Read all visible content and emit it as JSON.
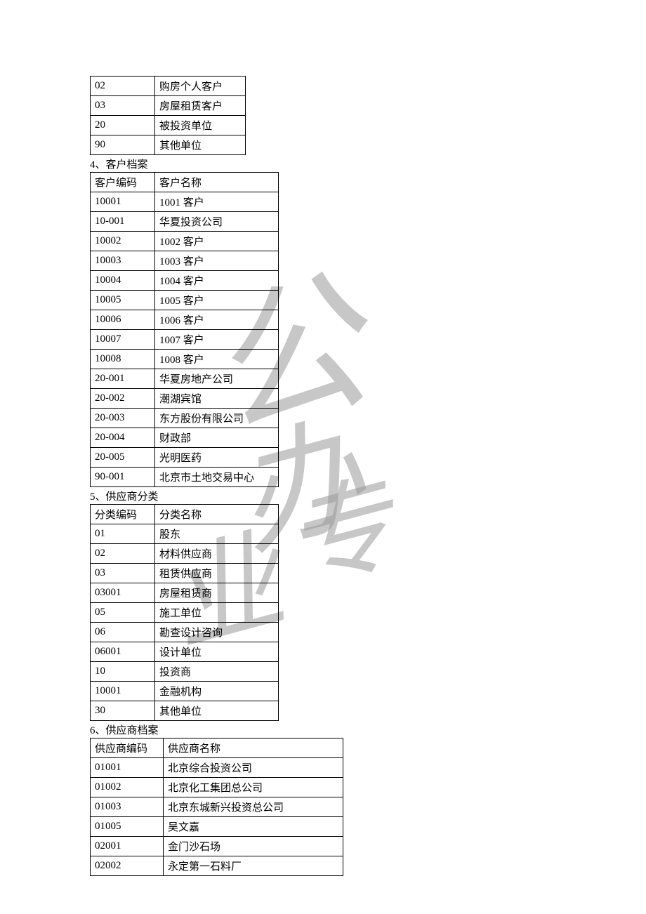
{
  "table0": {
    "rows": [
      {
        "c0": "02",
        "c1": "购房个人客户"
      },
      {
        "c0": "03",
        "c1": "房屋租赁客户"
      },
      {
        "c0": "20",
        "c1": "被投资单位"
      },
      {
        "c0": "90",
        "c1": "其他单位"
      }
    ]
  },
  "section1": {
    "title": "4、客户档案",
    "header": {
      "c0": "客户编码",
      "c1": "客户名称"
    },
    "rows": [
      {
        "c0": "10001",
        "c1": "1001 客户"
      },
      {
        "c0": "10-001",
        "c1": "华夏投资公司"
      },
      {
        "c0": "10002",
        "c1": "1002 客户"
      },
      {
        "c0": "10003",
        "c1": "1003 客户"
      },
      {
        "c0": "10004",
        "c1": "1004 客户"
      },
      {
        "c0": "10005",
        "c1": "1005 客户"
      },
      {
        "c0": "10006",
        "c1": "1006 客户"
      },
      {
        "c0": "10007",
        "c1": "1007 客户"
      },
      {
        "c0": "10008",
        "c1": "1008 客户"
      },
      {
        "c0": "20-001",
        "c1": "华夏房地产公司"
      },
      {
        "c0": "20-002",
        "c1": "潮湖宾馆"
      },
      {
        "c0": "20-003",
        "c1": "东方股份有限公司"
      },
      {
        "c0": "20-004",
        "c1": "财政部"
      },
      {
        "c0": "20-005",
        "c1": "光明医药"
      },
      {
        "c0": "90-001",
        "c1": "北京市土地交易中心"
      }
    ]
  },
  "section2": {
    "title": "5、供应商分类",
    "header": {
      "c0": "分类编码",
      "c1": "分类名称"
    },
    "rows": [
      {
        "c0": "01",
        "c1": "股东"
      },
      {
        "c0": "02",
        "c1": "材料供应商"
      },
      {
        "c0": "03",
        "c1": "租赁供应商"
      },
      {
        "c0": "03001",
        "c1": "房屋租赁商"
      },
      {
        "c0": "05",
        "c1": "施工单位"
      },
      {
        "c0": "06",
        "c1": "勘查设计咨询"
      },
      {
        "c0": "06001",
        "c1": "设计单位"
      },
      {
        "c0": "10",
        "c1": "投资商"
      },
      {
        "c0": "10001",
        "c1": "金融机构"
      },
      {
        "c0": "30",
        "c1": "其他单位"
      }
    ]
  },
  "section3": {
    "title": "6、供应商档案",
    "header": {
      "c0": "供应商编码",
      "c1": "供应商名称"
    },
    "rows": [
      {
        "c0": "01001",
        "c1": "北京综合投资公司"
      },
      {
        "c0": "01002",
        "c1": "北京化工集团总公司"
      },
      {
        "c0": "01003",
        "c1": "北京东城新兴投资总公司"
      },
      {
        "c0": "01005",
        "c1": "吴文嘉"
      },
      {
        "c0": "02001",
        "c1": "金门沙石场"
      },
      {
        "c0": "02002",
        "c1": "永定第一石料厂"
      }
    ]
  }
}
